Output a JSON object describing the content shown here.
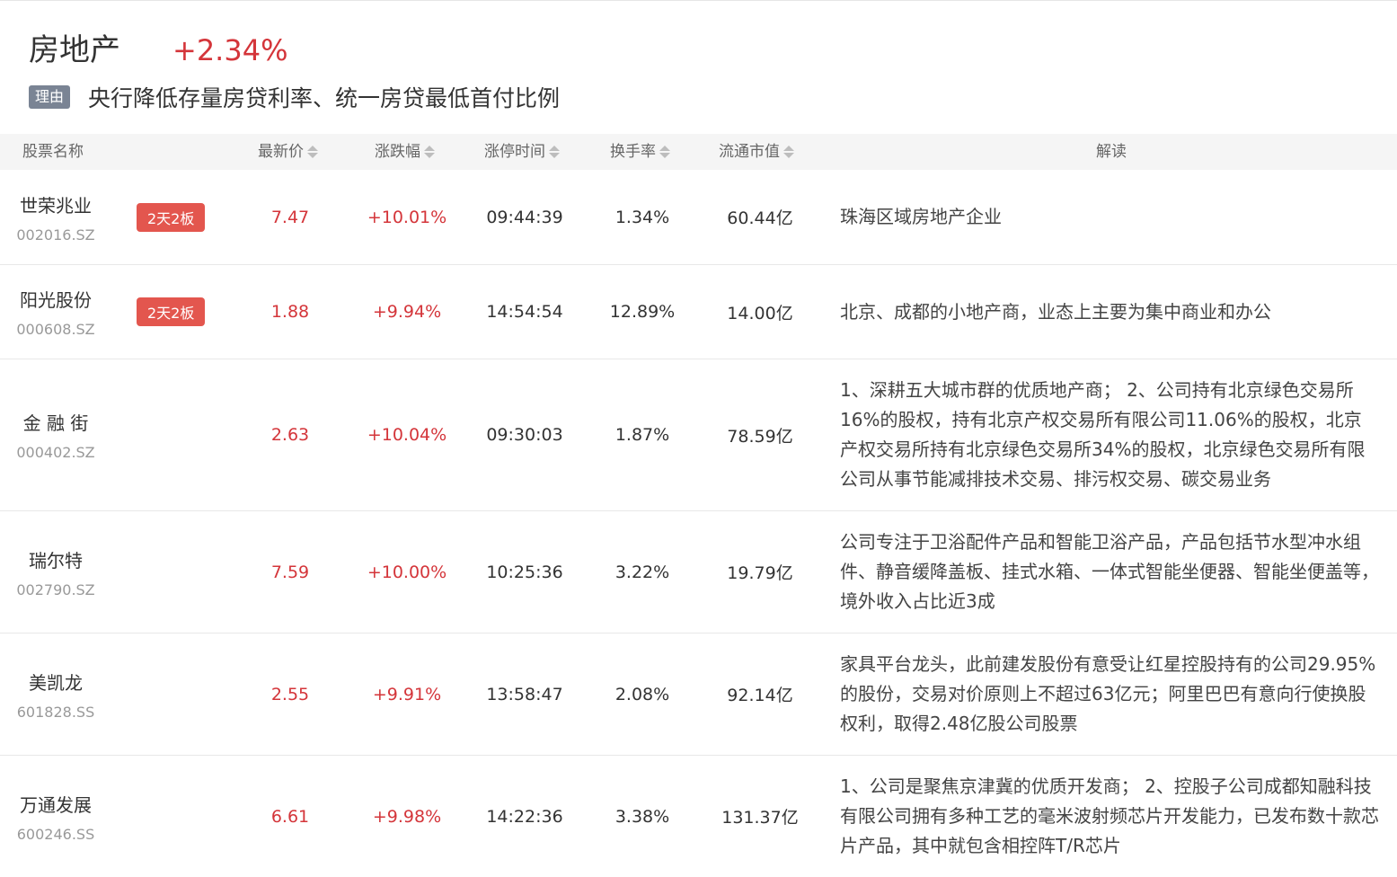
{
  "sector": {
    "name": "房地产",
    "change": "+2.34%",
    "reason_tag": "理由",
    "reason_text": "央行降低存量房贷利率、统一房贷最低首付比例"
  },
  "table": {
    "headers": {
      "name": "股票名称",
      "price": "最新价",
      "change": "涨跌幅",
      "limit_time": "涨停时间",
      "turnover": "换手率",
      "float_cap": "流通市值",
      "desc": "解读"
    },
    "rows": [
      {
        "name": "世荣兆业",
        "code": "002016.SZ",
        "badge": "2天2板",
        "price": "7.47",
        "change": "+10.01%",
        "limit_time": "09:44:39",
        "turnover": "1.34%",
        "float_cap": "60.44亿",
        "desc": "珠海区域房地产企业"
      },
      {
        "name": "阳光股份",
        "code": "000608.SZ",
        "badge": "2天2板",
        "price": "1.88",
        "change": "+9.94%",
        "limit_time": "14:54:54",
        "turnover": "12.89%",
        "float_cap": "14.00亿",
        "desc": "北京、成都的小地产商，业态上主要为集中商业和办公"
      },
      {
        "name": "金 融 街",
        "code": "000402.SZ",
        "badge": "",
        "price": "2.63",
        "change": "+10.04%",
        "limit_time": "09:30:03",
        "turnover": "1.87%",
        "float_cap": "78.59亿",
        "desc": "1、深耕五大城市群的优质地产商； 2、公司持有北京绿色交易所16%的股权，持有北京产权交易所有限公司11.06%的股权，北京产权交易所持有北京绿色交易所34%的股权，北京绿色交易所有限公司从事节能减排技术交易、排污权交易、碳交易业务"
      },
      {
        "name": "瑞尔特",
        "code": "002790.SZ",
        "badge": "",
        "price": "7.59",
        "change": "+10.00%",
        "limit_time": "10:25:36",
        "turnover": "3.22%",
        "float_cap": "19.79亿",
        "desc": "公司专注于卫浴配件产品和智能卫浴产品，产品包括节水型冲水组件、静音缓降盖板、挂式水箱、一体式智能坐便器、智能坐便盖等，境外收入占比近3成"
      },
      {
        "name": "美凯龙",
        "code": "601828.SS",
        "badge": "",
        "price": "2.55",
        "change": "+9.91%",
        "limit_time": "13:58:47",
        "turnover": "2.08%",
        "float_cap": "92.14亿",
        "desc": "家具平台龙头，此前建发股份有意受让红星控股持有的公司29.95%的股份，交易对价原则上不超过63亿元；阿里巴巴有意向行使换股权利，取得2.48亿股公司股票"
      },
      {
        "name": "万通发展",
        "code": "600246.SS",
        "badge": "",
        "price": "6.61",
        "change": "+9.98%",
        "limit_time": "14:22:36",
        "turnover": "3.38%",
        "float_cap": "131.37亿",
        "desc": "1、公司是聚焦京津冀的优质开发商； 2、控股子公司成都知融科技有限公司拥有多种工艺的毫米波射频芯片开发能力，已发布数十款芯片产品，其中就包含相控阵T/R芯片"
      }
    ]
  },
  "colors": {
    "up": "#d4353a",
    "badge": "#e3564e",
    "tag": "#7a8494",
    "header_bg": "#f5f5f5"
  }
}
